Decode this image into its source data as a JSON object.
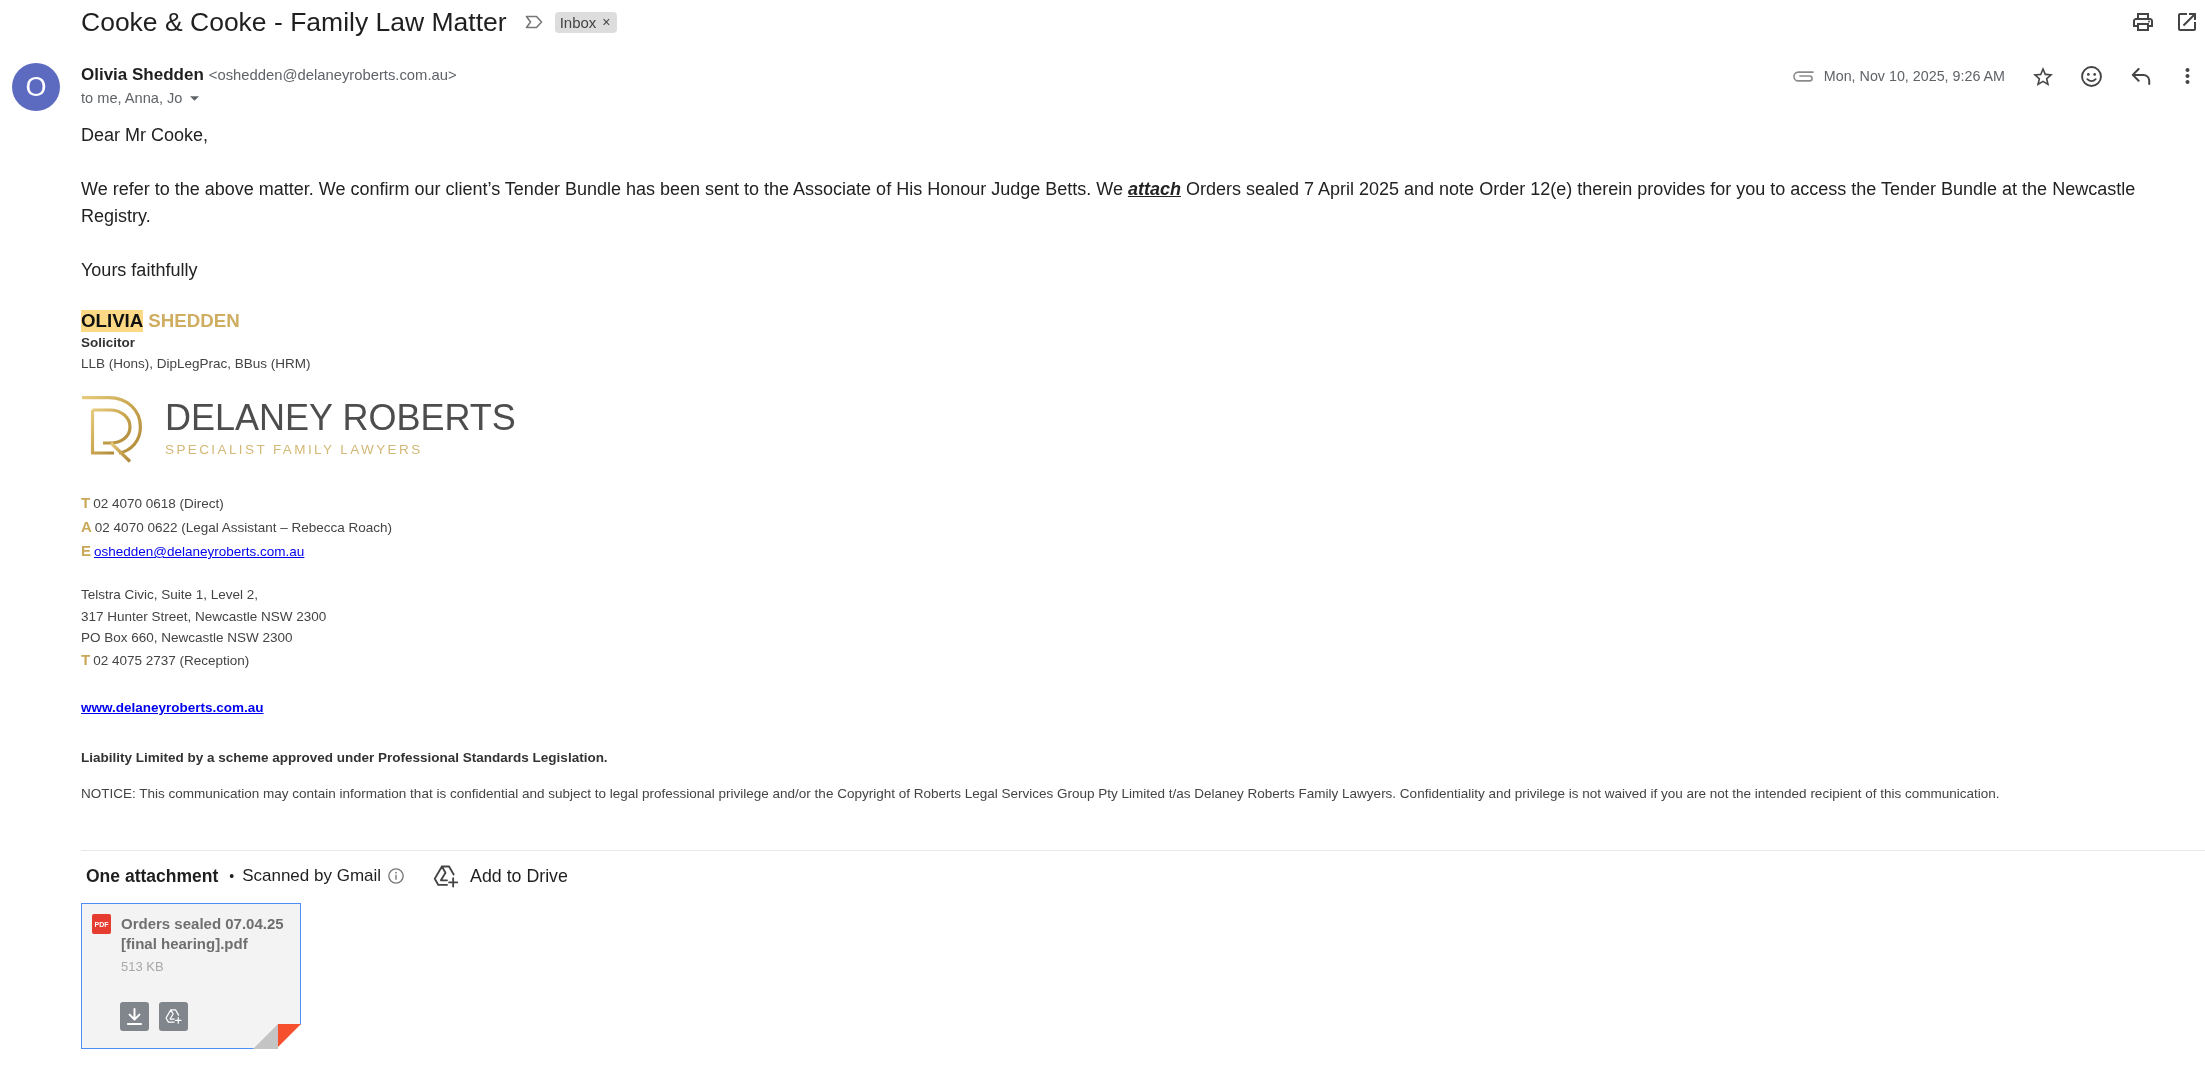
{
  "thread": {
    "subject": "Cooke & Cooke - Family Law Matter",
    "labels": [
      {
        "name": "Inbox",
        "remove": "×"
      }
    ]
  },
  "message": {
    "sender": {
      "initial": "O",
      "name": "Olivia Shedden",
      "email": "<oshedden@delaneyroberts.com.au>"
    },
    "recipients": "to me, Anna, Jo",
    "has_attachment": true,
    "date": "Mon, Nov 10, 2025, 9:26 AM",
    "starred": false
  },
  "body": {
    "greeting": "Dear Mr Cooke,",
    "paragraph": [
      {
        "kind": "plain",
        "text": "We refer to the above matter. We confirm our client’s Tender Bundle has been sent to the Associate of His Honour Judge Betts. We "
      },
      {
        "kind": "emphasis",
        "text": "attach"
      },
      {
        "kind": "plain",
        "text": " Orders sealed 7 April 2025 and note Order 12(e) therein provides for you to access the Tender Bundle at the Newcastle Registry."
      }
    ],
    "closing": "Yours faithfully"
  },
  "signature": {
    "name": [
      {
        "text": "OLIVIA",
        "highlighted": true
      },
      {
        "text": "SHEDDEN",
        "highlighted": false
      }
    ],
    "role": "Solicitor",
    "qualifications": "LLB (Hons), DipLegPrac, BBus (HRM)",
    "logo": {
      "name": "DELANEY ROBERTS",
      "tagline": "SPECIALIST FAMILY LAWYERS"
    },
    "contacts": [
      {
        "kind": "phone",
        "prefix": "T",
        "text": "02 4070 0618 (Direct)"
      },
      {
        "kind": "phone",
        "prefix": "A",
        "text": "02 4070 0622 (Legal Assistant – Rebecca Roach)"
      },
      {
        "kind": "email",
        "prefix": "E",
        "text": "oshedden@delaneyroberts.com.au"
      }
    ],
    "address": [
      {
        "text": "Telstra Civic, Suite 1, Level 2,"
      },
      {
        "text": "317 Hunter Street, Newcastle NSW 2300"
      },
      {
        "text": "PO Box 660, Newcastle NSW 2300"
      },
      {
        "prefix": "T",
        "text": "02 4075 2737 (Reception)"
      }
    ],
    "website": "www.delaneyroberts.com.au",
    "liability": "Liability Limited by a scheme approved under Professional Standards Legislation.",
    "notice": "NOTICE: This communication may contain information that is confidential and subject to legal professional privilege and/or the Copyright of Roberts Legal Services Group Pty Limited t/as Delaney Roberts Family Lawyers. Confidentiality and privilege is not waived if you are not the intended recipient of this communication."
  },
  "attachments": {
    "heading": "One attachment",
    "separator": "•",
    "scan_note": "Scanned by Gmail",
    "add_to_drive": "Add to Drive",
    "files": [
      {
        "type": "PDF",
        "name": "Orders sealed 07.04.25 [final hearing].pdf",
        "size": "513 KB",
        "selected": true
      }
    ]
  }
}
